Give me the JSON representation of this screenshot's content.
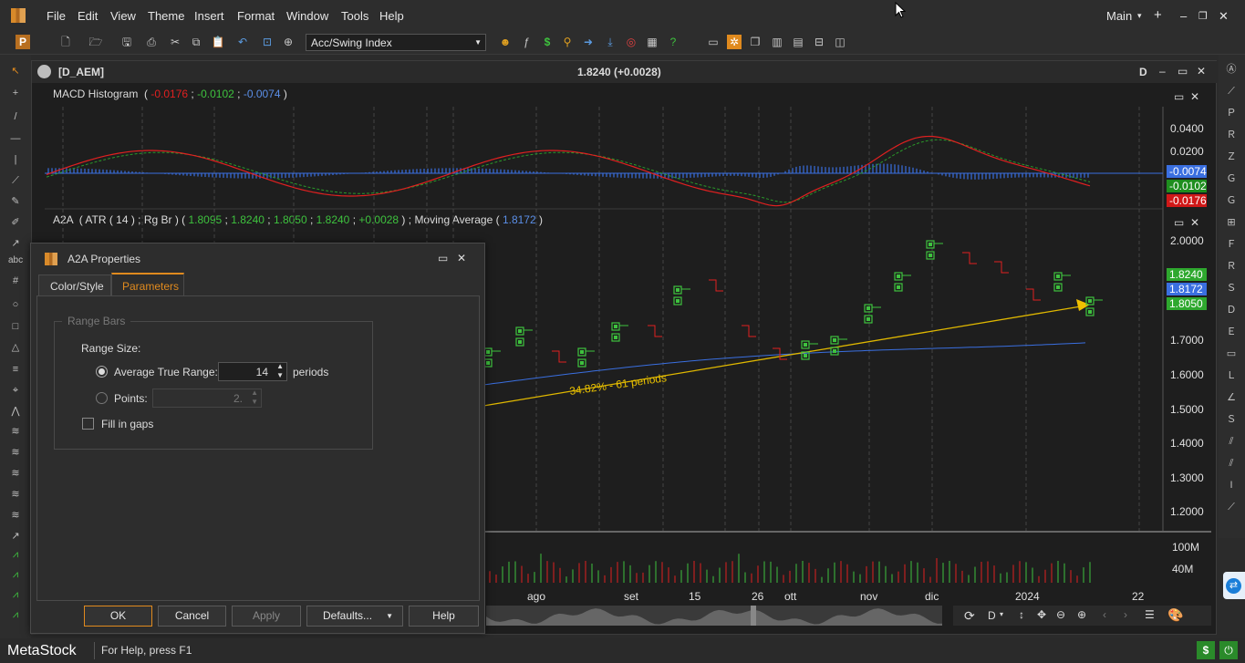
{
  "app": {
    "brand": "MetaStock",
    "workspace": "Main",
    "help_hint": "For Help, press F1"
  },
  "menu": [
    "File",
    "Edit",
    "View",
    "Theme",
    "Insert",
    "Format",
    "Window",
    "Tools",
    "Help"
  ],
  "toolbar": {
    "indicator_select": "Acc/Swing Index"
  },
  "chart": {
    "symbol": "[D_AEM]",
    "price_header": "1.8240 (+0.0028)",
    "periodicity": "D",
    "macd": {
      "label": "MACD Histogram",
      "v1": "-0.0176",
      "v2": "-0.0102",
      "v3": "-0.0074",
      "sep": ";"
    },
    "main_legend": {
      "prefix": "A2A",
      "params": "( ATR ( 14 ) ; Rg Br )",
      "o": "1.8095",
      "h": "1.8240",
      "l": "1.8050",
      "c": "1.8240",
      "chg": "+0.0028",
      "ma_label": "Moving Average",
      "ma_value": "1.8172"
    },
    "macd_axis": [
      "0.0400",
      "0.0200"
    ],
    "macd_badges": {
      "a": "-0.0074",
      "b": "-0.0102",
      "c": "-0.0176"
    },
    "price_axis": [
      "2.0000",
      "1.7000",
      "1.6000",
      "1.5000",
      "1.4000",
      "1.3000",
      "1.2000"
    ],
    "price_badges": {
      "close": "1.8240",
      "ma": "1.8172",
      "low": "1.8050"
    },
    "trend_label": "34.82% - 61 periods",
    "volume_axis": [
      "100M",
      "40M"
    ],
    "x_axis": [
      "ago",
      "set",
      "15",
      "26",
      "ott",
      "nov",
      "dic",
      "2024",
      "22"
    ],
    "nav_period": "D"
  },
  "colors": {
    "bg": "#1e1e1e",
    "up": "#3ec23e",
    "down": "#e02020",
    "ma": "#3a6fe0",
    "trend": "#f0c000",
    "accent": "#e08a1e"
  },
  "dialog": {
    "title": "A2A Properties",
    "tabs": [
      "Color/Style",
      "Parameters"
    ],
    "active_tab": "Parameters",
    "group": "Range Bars",
    "range_size_label": "Range Size:",
    "atr_label": "Average True Range:",
    "atr_value": "14",
    "atr_unit": "periods",
    "points_label": "Points:",
    "points_value": "2.",
    "fill_gaps": "Fill in gaps",
    "buttons": {
      "ok": "OK",
      "cancel": "Cancel",
      "apply": "Apply",
      "defaults": "Defaults...",
      "help": "Help"
    }
  }
}
